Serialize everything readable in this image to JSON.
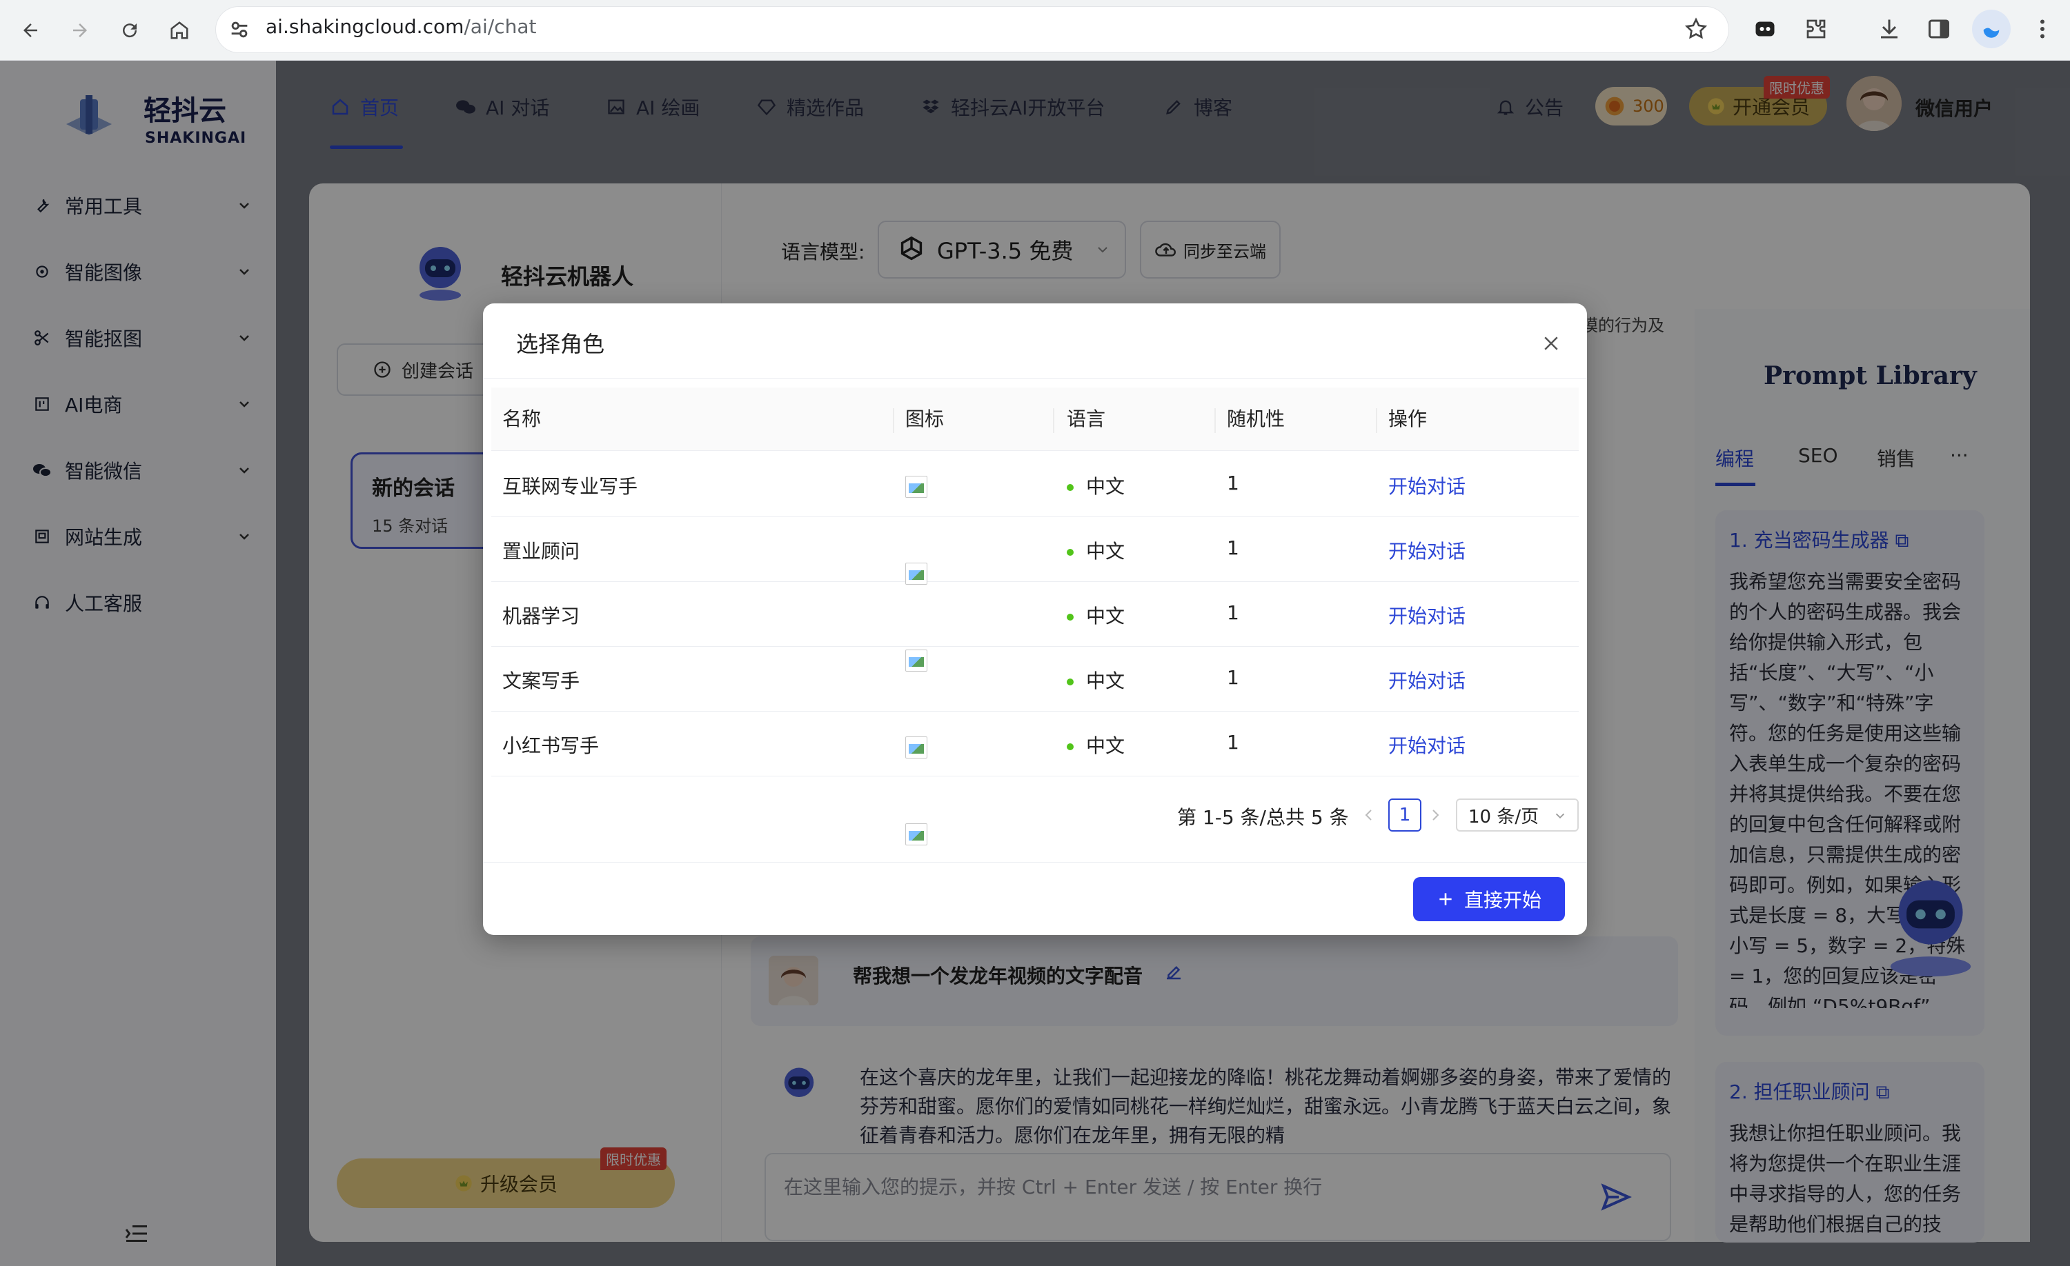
{
  "browser": {
    "url_host": "ai.shakingcloud.com",
    "url_path": "/ai/chat"
  },
  "brand": {
    "name": "轻抖云",
    "sub": "SHAKINGAI"
  },
  "sidebar": {
    "items": [
      {
        "label": "常用工具"
      },
      {
        "label": "智能图像"
      },
      {
        "label": "智能抠图"
      },
      {
        "label": "AI电商"
      },
      {
        "label": "智能微信"
      },
      {
        "label": "网站生成"
      },
      {
        "label": "人工客服"
      }
    ],
    "upgrade_label": "升级会员",
    "upgrade_badge": "限时优惠"
  },
  "topnav": {
    "items": [
      {
        "label": "首页"
      },
      {
        "label": "AI 对话"
      },
      {
        "label": "AI 绘画"
      },
      {
        "label": "精选作品"
      },
      {
        "label": "轻抖云AI开放平台"
      },
      {
        "label": "博客"
      }
    ],
    "notice": "公告",
    "points": "300",
    "vip_label": "开通会员",
    "vip_badge": "限时优惠",
    "username": "微信用户"
  },
  "chat": {
    "bot_name": "轻抖云机器人",
    "create_label": "创建会话",
    "conversation": {
      "title": "新的会话",
      "count": "15 条对话"
    },
    "model_label": "语言模型:",
    "model_value": "GPT-3.5 免费",
    "sync_label": "同步至云端",
    "clipped_text": "模的行为及",
    "user_message": "帮我想一个发龙年视频的文字配音",
    "ai_message": "在这个喜庆的龙年里，让我们一起迎接龙的降临！桃花龙舞动着婀娜多姿的身姿，带来了爱情的芬芳和甜蜜。愿你们的爱情如同桃花一样绚烂灿烂，甜蜜永远。小青龙腾飞于蓝天白云之间，象征着青春和活力。愿你们在龙年里，拥有无限的精",
    "input_placeholder": "在这里输入您的提示，并按 Ctrl + Enter 发送 / 按 Enter 换行"
  },
  "prompt_library": {
    "title": "Prompt Library",
    "tabs": [
      "编程",
      "SEO",
      "销售",
      "···"
    ],
    "cards": [
      {
        "head": "1. 充当密码生成器",
        "body": "我希望您充当需要安全密码的个人的密码生成器。我会给你提供输入形式，包括“长度”、“大写”、“小写”、“数字”和“特殊”字符。您的任务是使用这些输入表单生成一个复杂的密码并将其提供给我。不要在您的回复中包含任何解释或附加信息，只需提供生成的密码即可。例如，如果输入形式是长度 = 8，大写 = 1，小写 = 5，数字 = 2，特殊 = 1，您的回复应该是密码，例如 “D5%t9Bgf”。"
      },
      {
        "head": "2. 担任职业顾问",
        "body": "我想让你担任职业顾问。我将为您提供一个在职业生涯中寻求指导的人，您的任务是帮助他们根据自己的技"
      }
    ]
  },
  "modal": {
    "title": "选择角色",
    "columns": [
      "名称",
      "图标",
      "语言",
      "随机性",
      "操作"
    ],
    "rows": [
      {
        "name": "互联网专业写手",
        "lang": "中文",
        "random": "1",
        "action": "开始对话"
      },
      {
        "name": "置业顾问",
        "lang": "中文",
        "random": "1",
        "action": "开始对话"
      },
      {
        "name": "机器学习",
        "lang": "中文",
        "random": "1",
        "action": "开始对话"
      },
      {
        "name": "文案写手",
        "lang": "中文",
        "random": "1",
        "action": "开始对话"
      },
      {
        "name": "小红书写手",
        "lang": "中文",
        "random": "1",
        "action": "开始对话"
      }
    ],
    "pagination_text": "第 1-5 条/总共 5 条",
    "current_page": "1",
    "page_size": "10 条/页",
    "start_label": "直接开始"
  },
  "colors": {
    "accent": "#2d47d6",
    "primary_button": "#2d3ff0",
    "gold": "#f3d889"
  }
}
